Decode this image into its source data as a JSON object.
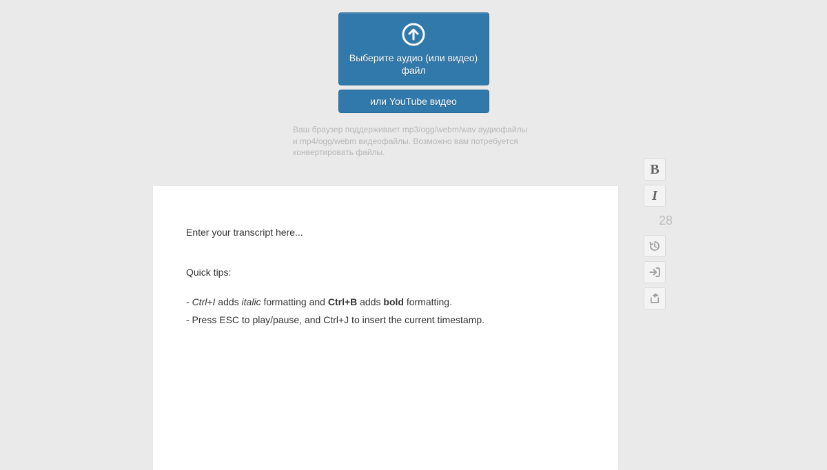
{
  "upload": {
    "select_label": "Выберите аудио (или видео) файл",
    "youtube_label": "или YouTube видео",
    "support_text": "Ваш браузер поддерживает mp3/ogg/webm/wav аудиофайлы и mp4/ogg/webm видеофайлы. Возможно вам потребуется конвертировать файлы."
  },
  "editor": {
    "placeholder": "Enter your transcript here...",
    "tips_heading": "Quick tips:",
    "tip1_prefix": "- ",
    "tip1_kb1": "Ctrl+I",
    "tip1_mid1": " adds ",
    "tip1_italic": "italic",
    "tip1_mid2": " formatting and ",
    "tip1_kb2": "Ctrl+B",
    "tip1_mid3": " adds ",
    "tip1_bold": "bold",
    "tip1_suffix": " formatting.",
    "tip2": "- Press ESC to play/pause, and Ctrl+J to insert the current timestamp."
  },
  "toolbar": {
    "bold_glyph": "B",
    "italic_glyph": "I",
    "word_count": "28"
  }
}
